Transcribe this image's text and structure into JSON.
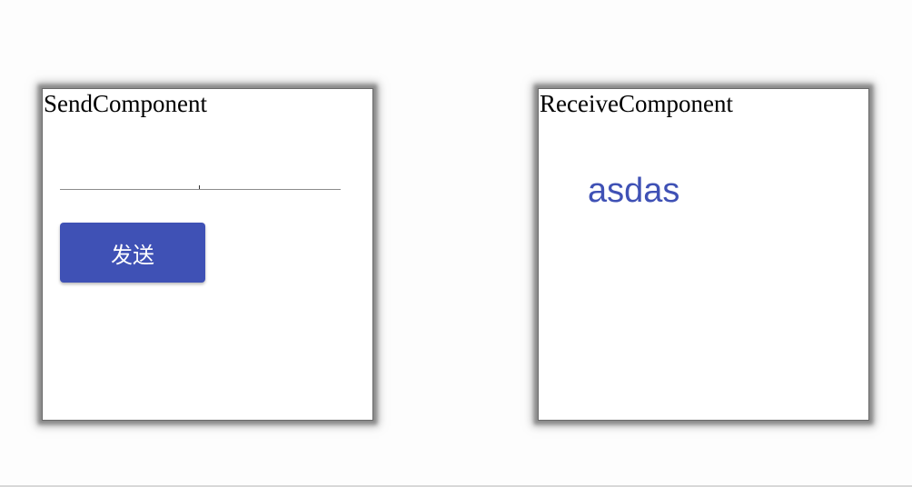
{
  "send_component": {
    "title": "SendComponent",
    "input": {
      "value": "",
      "placeholder": ""
    },
    "button_label": "发送"
  },
  "receive_component": {
    "title": "ReceiveComponent",
    "message": "asdas"
  },
  "colors": {
    "accent": "#3f51b5",
    "panel_background": "#ffffff",
    "page_background": "#fdfdfd"
  }
}
